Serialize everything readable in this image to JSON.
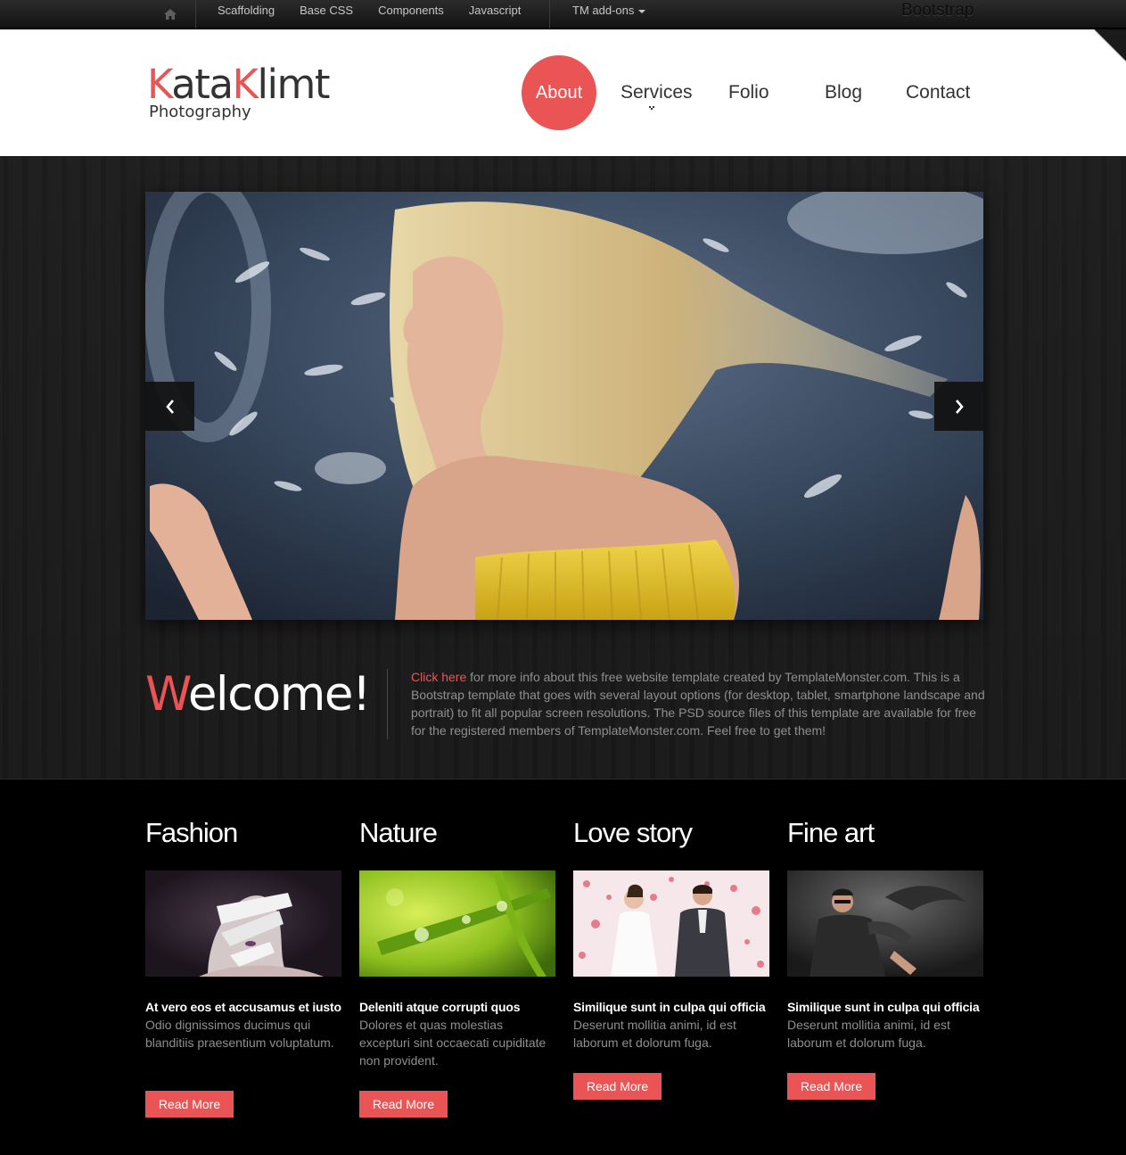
{
  "topbar": {
    "home_icon": "home-icon",
    "links": [
      "Scaffolding",
      "Base CSS",
      "Components",
      "Javascript"
    ],
    "dropdown_label": "TM add-ons",
    "brand": "Bootstrap"
  },
  "header": {
    "logo": {
      "part1_accent": "K",
      "part1": "ata",
      "part2_accent": "K",
      "part2": "limt",
      "subtitle": "Photography"
    },
    "nav": [
      "About",
      "Services",
      "Folio",
      "Blog",
      "Contact"
    ],
    "active_nav": "About"
  },
  "hero": {
    "slider": {
      "prev_icon": "chevron-left-icon",
      "next_icon": "chevron-right-icon"
    },
    "welcome_accent": "W",
    "welcome_rest": "elcome!",
    "intro_link": "Click here",
    "intro_text": " for more info about this free website template created by TemplateMonster.com. This is a Bootstrap template that goes with several layout options (for desktop, tablet, smartphone landscape and portrait) to fit all popular screen resolutions. The PSD source files of this template are available for free for the registered members of TemplateMonster.com. Feel free to get them!"
  },
  "categories": [
    {
      "heading": "Fashion",
      "title": "At vero eos et accusamus et iusto",
      "text": "Odio dignissimos ducimus qui blanditiis praesentium voluptatum.",
      "button": "Read More"
    },
    {
      "heading": "Nature",
      "title": "Deleniti atque corrupti quos",
      "text": "Dolores et quas molestias excepturi sint occaecati cupiditate non provident.",
      "button": "Read More"
    },
    {
      "heading": "Love story",
      "title": "Similique sunt in culpa qui officia",
      "text": "Deserunt mollitia animi, id est laborum et dolorum fuga.",
      "button": "Read More"
    },
    {
      "heading": "Fine art",
      "title": "Similique sunt in culpa qui officia",
      "text": "Deserunt mollitia animi, id est laborum et dolorum fuga.",
      "button": "Read More"
    }
  ],
  "colors": {
    "accent": "#ea5454",
    "header_bg": "#ffffff",
    "hero_bg": "#1b1b1b",
    "body_bg": "#000000",
    "muted_text": "#8f8f8f"
  }
}
